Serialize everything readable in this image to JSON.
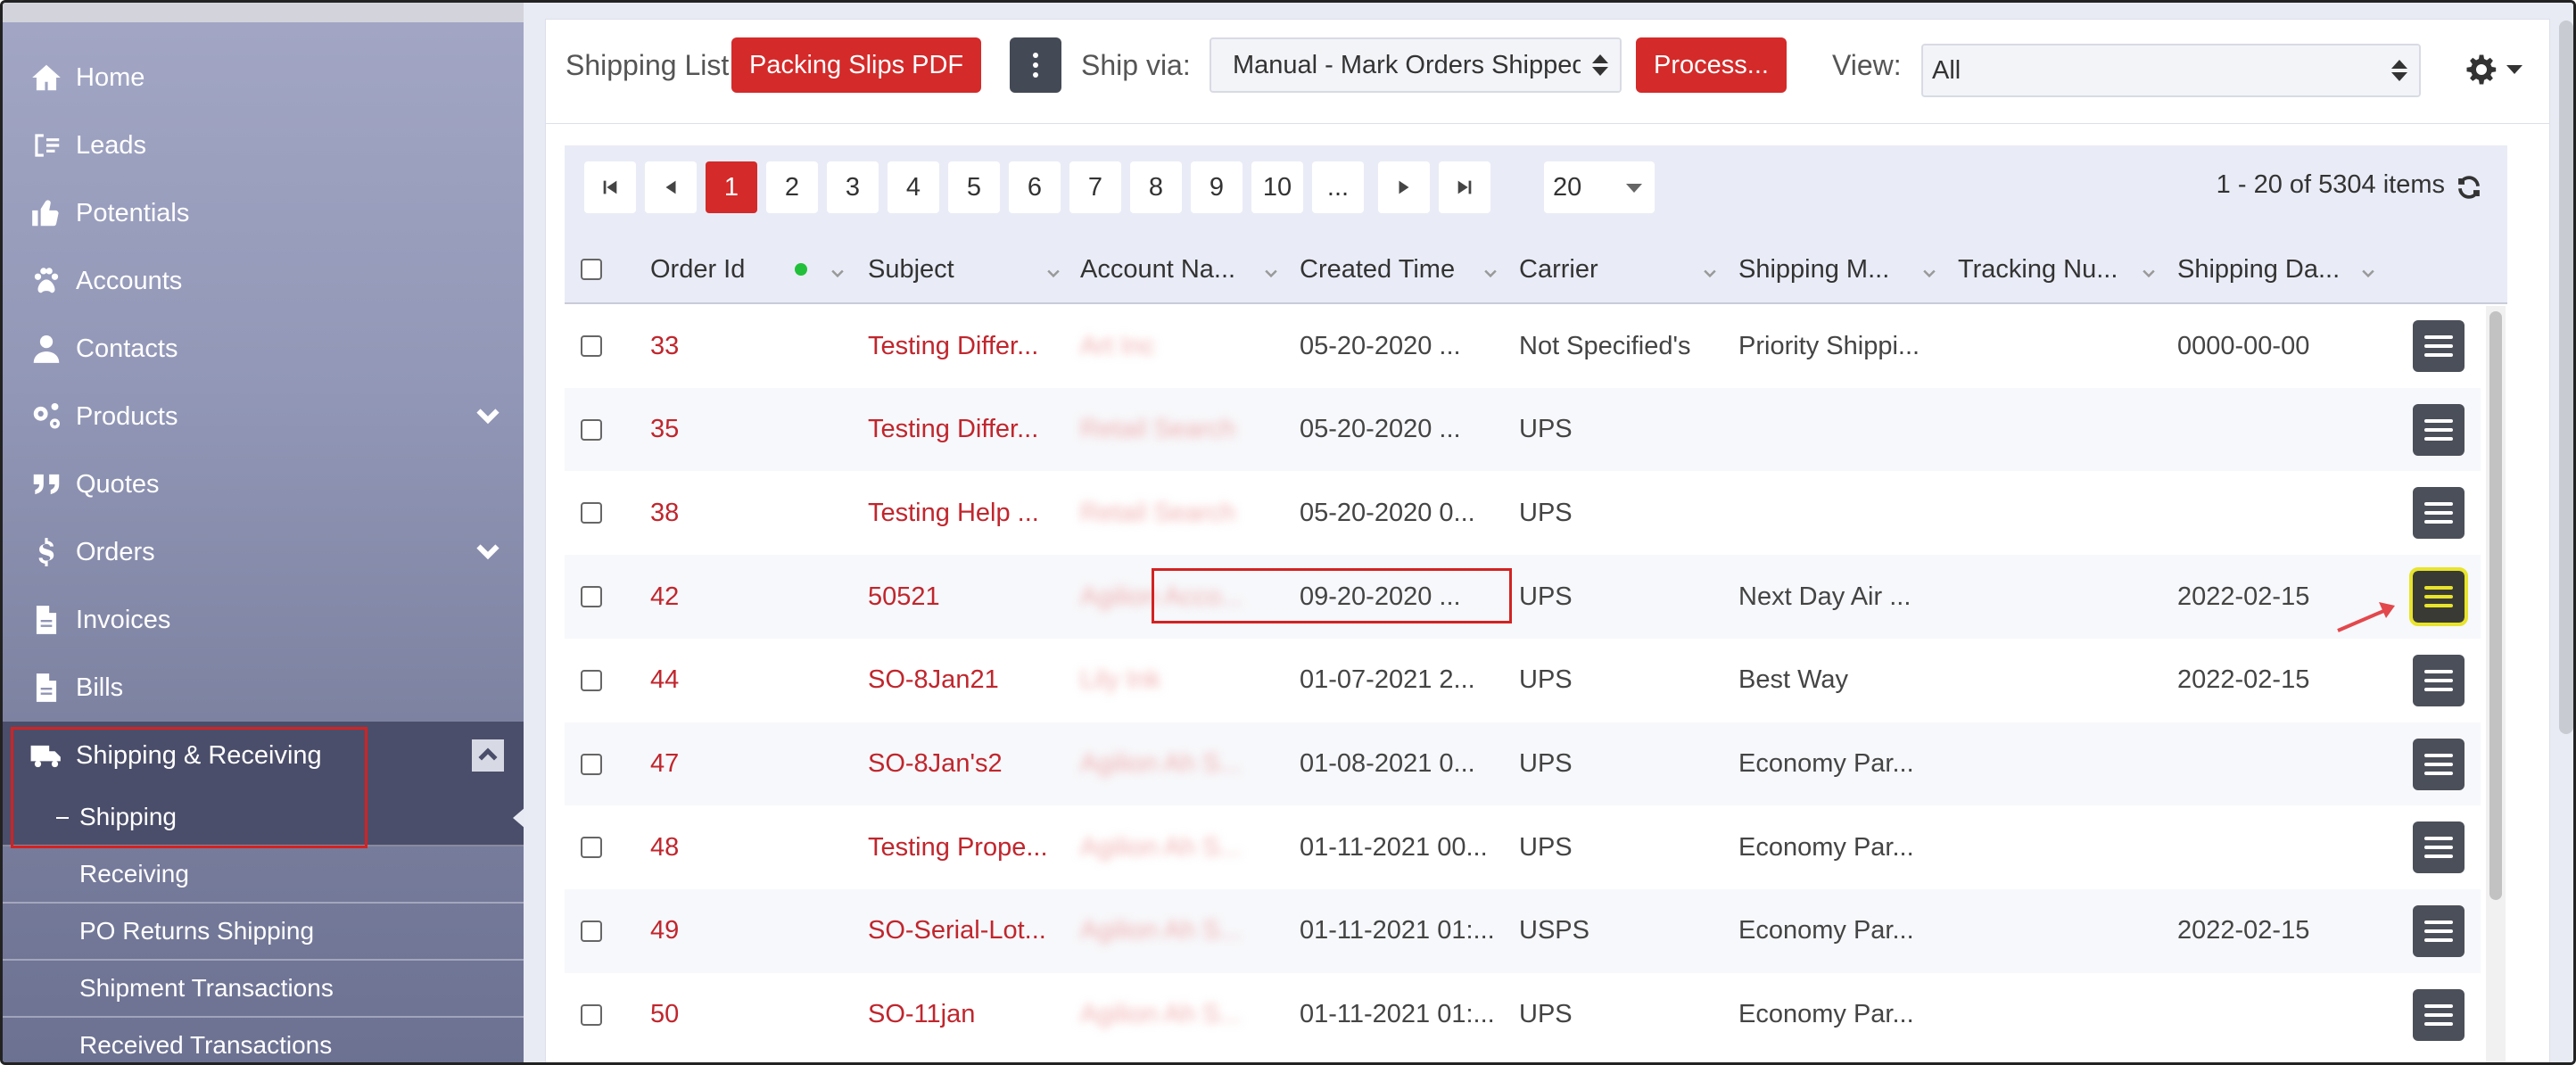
{
  "sidebar": {
    "items": [
      {
        "label": "Home",
        "icon": "home-icon"
      },
      {
        "label": "Leads",
        "icon": "leads-icon"
      },
      {
        "label": "Potentials",
        "icon": "thumbs-up-icon"
      },
      {
        "label": "Accounts",
        "icon": "paw-icon"
      },
      {
        "label": "Contacts",
        "icon": "user-icon"
      },
      {
        "label": "Products",
        "icon": "gears-icon"
      },
      {
        "label": "Quotes",
        "icon": "quote-icon"
      },
      {
        "label": "Orders",
        "icon": "dollar-icon"
      },
      {
        "label": "Invoices",
        "icon": "file-icon"
      },
      {
        "label": "Bills",
        "icon": "file-icon"
      },
      {
        "label": "Shipping & Receiving",
        "icon": "truck-icon"
      }
    ],
    "sub_items": [
      {
        "label": "Shipping",
        "active": true
      },
      {
        "label": "Receiving"
      },
      {
        "label": "PO Returns Shipping"
      },
      {
        "label": "Shipment Transactions"
      },
      {
        "label": "Received Transactions"
      }
    ]
  },
  "toolbar": {
    "title": "Shipping List",
    "packing_slips": "Packing Slips PDF",
    "ship_via_label": "Ship via:",
    "ship_via_value": "Manual - Mark Orders Shipped",
    "process": "Process...",
    "view_label": "View:",
    "view_value": "All"
  },
  "pager": {
    "pages": [
      "1",
      "2",
      "3",
      "4",
      "5",
      "6",
      "7",
      "8",
      "9",
      "10",
      "..."
    ],
    "current": "1",
    "page_size": "20",
    "items_info": "1 - 20 of 5304 items"
  },
  "table": {
    "columns": [
      "Order Id",
      "Subject",
      "Account Na...",
      "Created Time",
      "Carrier",
      "Shipping M...",
      "Tracking Nu...",
      "Shipping Da..."
    ],
    "rows": [
      {
        "order_id": "33",
        "subject": "Testing Differ...",
        "account": "Art Inc",
        "created": "05-20-2020 ...",
        "carrier": "Not Specified's",
        "method": "Priority Shippi...",
        "tracking": "",
        "ship_date": "0000-00-00"
      },
      {
        "order_id": "35",
        "subject": "Testing Differ...",
        "account": "Retail Search",
        "created": "05-20-2020 ...",
        "carrier": "UPS",
        "method": "",
        "tracking": "",
        "ship_date": ""
      },
      {
        "order_id": "38",
        "subject": "Testing Help ...",
        "account": "Retail Search",
        "created": "05-20-2020 0...",
        "carrier": "UPS",
        "method": "",
        "tracking": "",
        "ship_date": ""
      },
      {
        "order_id": "42",
        "subject": "50521",
        "account": "Agilion Acco...",
        "created": "09-20-2020 ...",
        "carrier": "UPS",
        "method": "Next Day Air ...",
        "tracking": "",
        "ship_date": "2022-02-15"
      },
      {
        "order_id": "44",
        "subject": "SO-8Jan21",
        "account": "Lily Ink",
        "created": "01-07-2021 2...",
        "carrier": "UPS",
        "method": "Best Way",
        "tracking": "",
        "ship_date": "2022-02-15"
      },
      {
        "order_id": "47",
        "subject": "SO-8Jan's2",
        "account": "Agilion Ah S...",
        "created": "01-08-2021 0...",
        "carrier": "UPS",
        "method": "Economy Par...",
        "tracking": "",
        "ship_date": ""
      },
      {
        "order_id": "48",
        "subject": "Testing Prope...",
        "account": "Agilion Ah S...",
        "created": "01-11-2021 00...",
        "carrier": "UPS",
        "method": "Economy Par...",
        "tracking": "",
        "ship_date": ""
      },
      {
        "order_id": "49",
        "subject": "SO-Serial-Lot...",
        "account": "Agilion Ah S...",
        "created": "01-11-2021 01:...",
        "carrier": "USPS",
        "method": "Economy Par...",
        "tracking": "",
        "ship_date": "2022-02-15"
      },
      {
        "order_id": "50",
        "subject": "SO-11jan",
        "account": "Agilion Ah S...",
        "created": "01-11-2021 01:...",
        "carrier": "UPS",
        "method": "Economy Par...",
        "tracking": "",
        "ship_date": ""
      }
    ]
  },
  "colors": {
    "accent_red": "#d42a2a",
    "link_red": "#c0262d",
    "highlight_yellow": "#e8e42c"
  }
}
